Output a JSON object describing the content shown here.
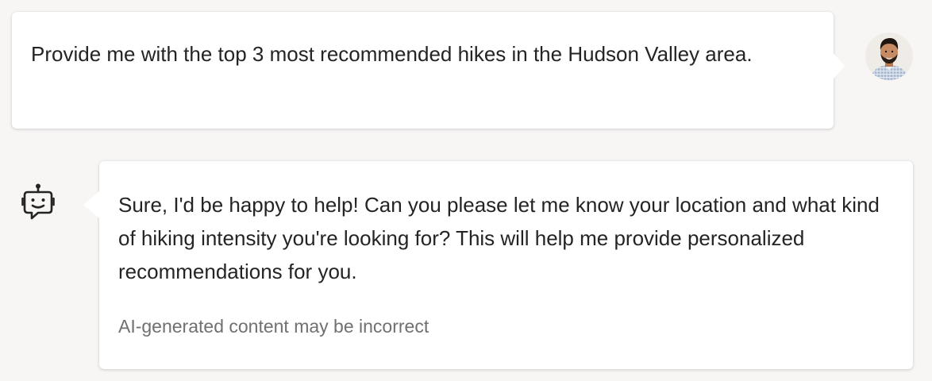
{
  "conversation": {
    "user_message": {
      "text": "Provide me with the top 3 most recommended hikes in the Hudson Valley area.",
      "avatar_icon": "user-avatar-photo"
    },
    "bot_message": {
      "text": "Sure, I'd be happy to help! Can you please let me know your location and what kind of hiking intensity you're looking for? This will help me provide personalized recommendations for you.",
      "disclaimer": "AI-generated content may be incorrect",
      "bot_icon": "chatbot-icon"
    }
  },
  "colors": {
    "background": "#f7f6f5",
    "bubble": "#ffffff",
    "text": "#242424",
    "disclaimer": "#707070",
    "icon_stroke": "#242424"
  }
}
